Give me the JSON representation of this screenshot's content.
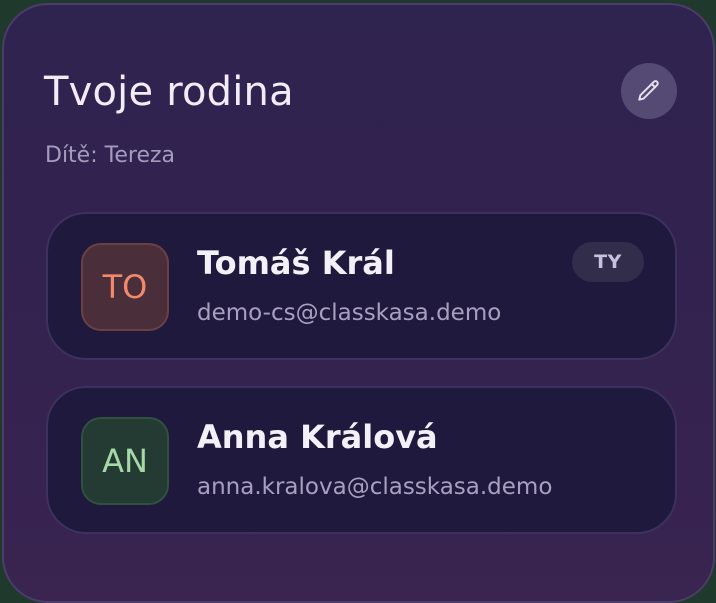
{
  "family": {
    "title": "Tvoje rodina",
    "child_label": "Dítě:",
    "child_name": "Tereza"
  },
  "icons": {
    "edit": "pencil-icon"
  },
  "members": [
    {
      "initials": "TO",
      "name": "Tomáš Král",
      "email": "demo-cs@classkasa.demo",
      "badge": "TY",
      "avatar_bg": "#4a2f3a",
      "avatar_border": "#6a4045",
      "avatar_text": "#f08a6a"
    },
    {
      "initials": "AN",
      "name": "Anna Králová",
      "email": "anna.kralova@classkasa.demo",
      "avatar_bg": "#233b32",
      "avatar_border": "#30513f",
      "avatar_text": "#a6d8a8"
    }
  ]
}
